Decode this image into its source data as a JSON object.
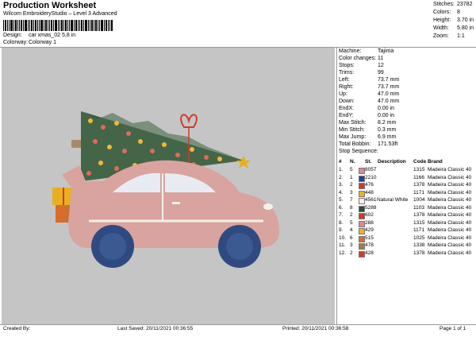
{
  "header": {
    "title": "Production Worksheet",
    "subtitle": "Wilcom EmbroideryStudio – Level 3 Advanced",
    "design_label": "Design:",
    "design_value": "car xmas_02 5,8 in",
    "colorway_label": "Colorway:",
    "colorway_value": "Colorway 1"
  },
  "stats": [
    {
      "label": "Stitches:",
      "value": "23782"
    },
    {
      "label": "Colors:",
      "value": "8"
    },
    {
      "label": "Height:",
      "value": "3.70 in"
    },
    {
      "label": "Width:",
      "value": "5.80 in"
    },
    {
      "label": "Zoom:",
      "value": "1:1"
    }
  ],
  "machine_info": [
    {
      "label": "Machine:",
      "value": "Tajima"
    },
    {
      "label": "Color changes:",
      "value": "11"
    },
    {
      "label": "Stops:",
      "value": "12"
    },
    {
      "label": "Trims:",
      "value": "99"
    },
    {
      "label": "Left:",
      "value": "73.7 mm"
    },
    {
      "label": "Right:",
      "value": "73.7 mm"
    },
    {
      "label": "Up:",
      "value": "47.0 mm"
    },
    {
      "label": "Down:",
      "value": "47.0 mm"
    },
    {
      "label": "EndX:",
      "value": "0.00 in"
    },
    {
      "label": "EndY:",
      "value": "0.00 in"
    },
    {
      "label": "Max Stitch:",
      "value": "8.2 mm"
    },
    {
      "label": "Min Stitch:",
      "value": "0.3 mm"
    },
    {
      "label": "Max Jump:",
      "value": "6.9 mm"
    },
    {
      "label": "Total Bobbin:",
      "value": "171.53ft"
    }
  ],
  "stop_sequence": {
    "title": "Stop Sequence:",
    "columns": [
      "#",
      "N.",
      "St.",
      "Description",
      "Code",
      "Brand"
    ],
    "rows": [
      {
        "num": "1.",
        "n": "5",
        "color": "#d98b91",
        "st": "8057",
        "desc": "",
        "code": "1315",
        "brand": "Madeira Classic 40"
      },
      {
        "num": "2.",
        "n": "1",
        "color": "#2b3f8c",
        "st": "2210",
        "desc": "",
        "code": "1166",
        "brand": "Madeira Classic 40"
      },
      {
        "num": "3.",
        "n": "2",
        "color": "#cf3a2c",
        "st": "476",
        "desc": "",
        "code": "1378",
        "brand": "Madeira Classic 40"
      },
      {
        "num": "4.",
        "n": "3",
        "color": "#e7b326",
        "st": "448",
        "desc": "",
        "code": "1171",
        "brand": "Madeira Classic 40"
      },
      {
        "num": "5.",
        "n": "7",
        "color": "#f4f1e8",
        "st": "4561",
        "desc": "Natural White",
        "code": "1004",
        "brand": "Madeira Classic 40"
      },
      {
        "num": "6.",
        "n": "8",
        "color": "#2f4a3a",
        "st": "5288",
        "desc": "",
        "code": "1103",
        "brand": "Madeira Classic 40"
      },
      {
        "num": "7.",
        "n": "2",
        "color": "#cf3a2c",
        "st": "602",
        "desc": "",
        "code": "1378",
        "brand": "Madeira Classic 40"
      },
      {
        "num": "8.",
        "n": "5",
        "color": "#d98b91",
        "st": "288",
        "desc": "",
        "code": "1315",
        "brand": "Madeira Classic 40"
      },
      {
        "num": "9.",
        "n": "4",
        "color": "#f0b020",
        "st": "429",
        "desc": "",
        "code": "1171",
        "brand": "Madeira Classic 40"
      },
      {
        "num": "10.",
        "n": "6",
        "color": "#d96c2a",
        "st": "515",
        "desc": "",
        "code": "1025",
        "brand": "Madeira Classic 40"
      },
      {
        "num": "11.",
        "n": "3",
        "color": "#a87a4a",
        "st": "478",
        "desc": "",
        "code": "1338",
        "brand": "Madeira Classic 40"
      },
      {
        "num": "12.",
        "n": "2",
        "color": "#cf3a2c",
        "st": "428",
        "desc": "",
        "code": "1378",
        "brand": "Madeira Classic 40"
      }
    ]
  },
  "footer": {
    "created_by": "Created By:",
    "last_saved": "Last Saved: 20/11/2021 00:36:55",
    "printed": "Printed: 20/11/2021 00:36:58",
    "page": "Page 1 of 1"
  },
  "colors": {
    "design_background": "#c5c5c5",
    "car_body": "#d9a3a0",
    "tree": "#3f5c43",
    "wheel": "#2f4a80"
  }
}
